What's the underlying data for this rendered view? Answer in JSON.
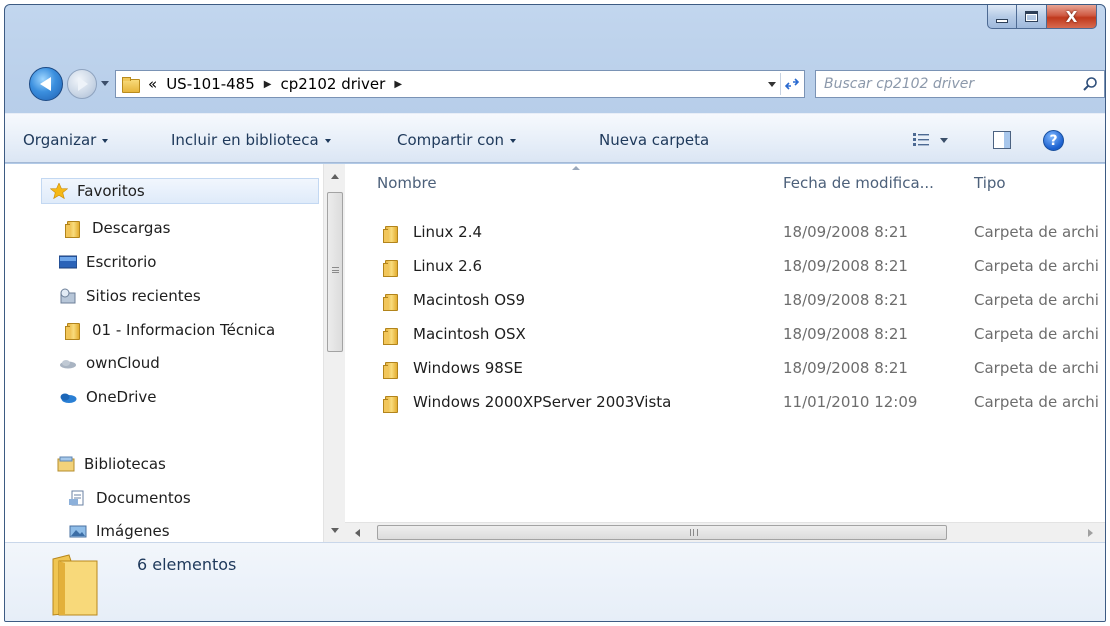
{
  "window": {
    "caption": {
      "minimize_glyph": "_",
      "maximize_glyph": "□",
      "close_glyph": "X"
    }
  },
  "address_bar": {
    "overflow": "«",
    "crumbs": [
      "US-101-485",
      "cp2102 driver"
    ],
    "separator": "▶"
  },
  "search": {
    "placeholder": "Buscar cp2102 driver"
  },
  "toolbar": {
    "organize": "Organizar",
    "include_library": "Incluir en biblioteca",
    "share_with": "Compartir con",
    "new_folder": "Nueva carpeta",
    "help": "?"
  },
  "nav": {
    "favorites": "Favoritos",
    "items": [
      {
        "label": "Descargas",
        "icon": "downloads-icon"
      },
      {
        "label": "Escritorio",
        "icon": "desktop-icon"
      },
      {
        "label": "Sitios recientes",
        "icon": "recent-places-icon"
      },
      {
        "label": "01 - Informacion Técnica",
        "icon": "folder-icon"
      },
      {
        "label": "ownCloud",
        "icon": "owncloud-icon"
      },
      {
        "label": "OneDrive",
        "icon": "onedrive-icon"
      }
    ],
    "libraries": "Bibliotecas",
    "library_items": [
      {
        "label": "Documentos",
        "icon": "documents-icon"
      },
      {
        "label": "Imágenes",
        "icon": "pictures-icon"
      }
    ]
  },
  "files": {
    "columns": {
      "name": "Nombre",
      "date": "Fecha de modifica...",
      "type": "Tipo"
    },
    "rows": [
      {
        "name": "Linux 2.4",
        "date": "18/09/2008 8:21",
        "type": "Carpeta de archi"
      },
      {
        "name": "Linux 2.6",
        "date": "18/09/2008 8:21",
        "type": "Carpeta de archi"
      },
      {
        "name": "Macintosh OS9",
        "date": "18/09/2008 8:21",
        "type": "Carpeta de archi"
      },
      {
        "name": "Macintosh OSX",
        "date": "18/09/2008 8:21",
        "type": "Carpeta de archi"
      },
      {
        "name": "Windows 98SE",
        "date": "18/09/2008 8:21",
        "type": "Carpeta de archi"
      },
      {
        "name": "Windows 2000XPServer 2003Vista",
        "date": "11/01/2010 12:09",
        "type": "Carpeta de archi"
      }
    ]
  },
  "details": {
    "count": "6 elementos"
  },
  "colors": {
    "frame": "#9ab7dc",
    "command_bar": "#e9f0f9",
    "link_text": "#1e395b",
    "folder": "#f9dc7d"
  }
}
